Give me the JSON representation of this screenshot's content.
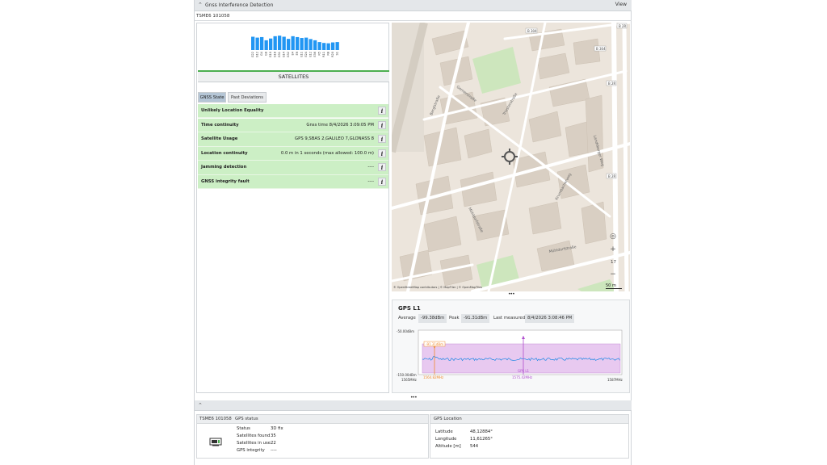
{
  "window": {
    "title": "Gnss Interference Detection",
    "view_label": "View"
  },
  "device": "TSME6 101058",
  "satellites": {
    "label": "SATELLITES",
    "bar_color": "#2196f3",
    "bars": [
      {
        "id": "G22",
        "level": 0.75
      },
      {
        "id": "G12",
        "level": 0.7
      },
      {
        "id": "G4",
        "level": 0.73
      },
      {
        "id": "G8",
        "level": 0.55
      },
      {
        "id": "G10",
        "level": 0.65
      },
      {
        "id": "G18",
        "level": 0.78
      },
      {
        "id": "G31",
        "level": 0.81
      },
      {
        "id": "G14",
        "level": 0.75
      },
      {
        "id": "G32",
        "level": 0.63
      },
      {
        "id": "E4",
        "level": 0.78
      },
      {
        "id": "E9",
        "level": 0.73
      },
      {
        "id": "E11",
        "level": 0.68
      },
      {
        "id": "E24",
        "level": 0.7
      },
      {
        "id": "E12",
        "level": 0.62
      },
      {
        "id": "E36",
        "level": 0.55
      },
      {
        "id": "R5",
        "level": 0.45
      },
      {
        "id": "R11",
        "level": 0.4
      },
      {
        "id": "R8",
        "level": 0.38
      },
      {
        "id": "R20",
        "level": 0.43
      },
      {
        "id": "S1",
        "level": 0.45
      }
    ]
  },
  "tabs": [
    "GNSS State",
    "Past Deviations"
  ],
  "status_rows": [
    {
      "label": "Unlikely Location Equality",
      "value": ""
    },
    {
      "label": "Time continuity",
      "value": "Gnss time 8/4/2026 3:09:05 PM"
    },
    {
      "label": "Satellite Usage",
      "value": "GPS 9,SBAS 2,GALILEO 7,GLONASS 8"
    },
    {
      "label": "Location continuity",
      "value": "0.0 m in 1 seconds (max allowed: 100.0 m)"
    },
    {
      "label": "Jamming detection",
      "value": "----"
    },
    {
      "label": "GNSS integrity fault",
      "value": "----"
    }
  ],
  "status_ok_color": "#ccefc5",
  "map": {
    "zoom": "17",
    "scale": "50 m",
    "attribution": "© OpenStreetMap contributors | © MapTiler | © OpenMapTiles",
    "streets": [
      "Gernerstraße",
      "Berglstraße",
      "Triesterstraße",
      "Mühldorfstraße",
      "Krumbacherweg",
      "Landsberger Weg"
    ],
    "road_labels": [
      "B 304",
      "B 2R",
      "B 304",
      "B 2R",
      "B 2R"
    ]
  },
  "gps_panel": {
    "title": "GPS L1",
    "average_label": "Average",
    "average_value": "-99.38dBm",
    "peak_label": "Peak",
    "peak_value": "-91.31dBm",
    "last_label": "Last measured",
    "last_value": "8/4/2026 3:08:46 PM",
    "y_top": "-50.00dBm",
    "y_bottom": "-150.00dBm",
    "x_left": "1565MHz",
    "x_right": "1587MHz",
    "peak_marker": "-91.31dBm",
    "peak_freq": "1564.82MHz",
    "center_label": "GPS L1",
    "center_freq": "1575.42MHz"
  },
  "bottom": {
    "device": "TSME6 101058",
    "status_header": "GPS status",
    "status_rows": [
      {
        "k": "Status",
        "v": "3D fix"
      },
      {
        "k": "Satellites found",
        "v": "35"
      },
      {
        "k": "Satellites in use",
        "v": "22"
      },
      {
        "k": "GPS integrity",
        "v": "----"
      }
    ],
    "location_header": "GPS Location",
    "location_rows": [
      {
        "k": "Latitude",
        "v": "48,12884°"
      },
      {
        "k": "Longitude",
        "v": "11,61265°"
      },
      {
        "k": "Altitude [m]",
        "v": "544"
      }
    ]
  }
}
